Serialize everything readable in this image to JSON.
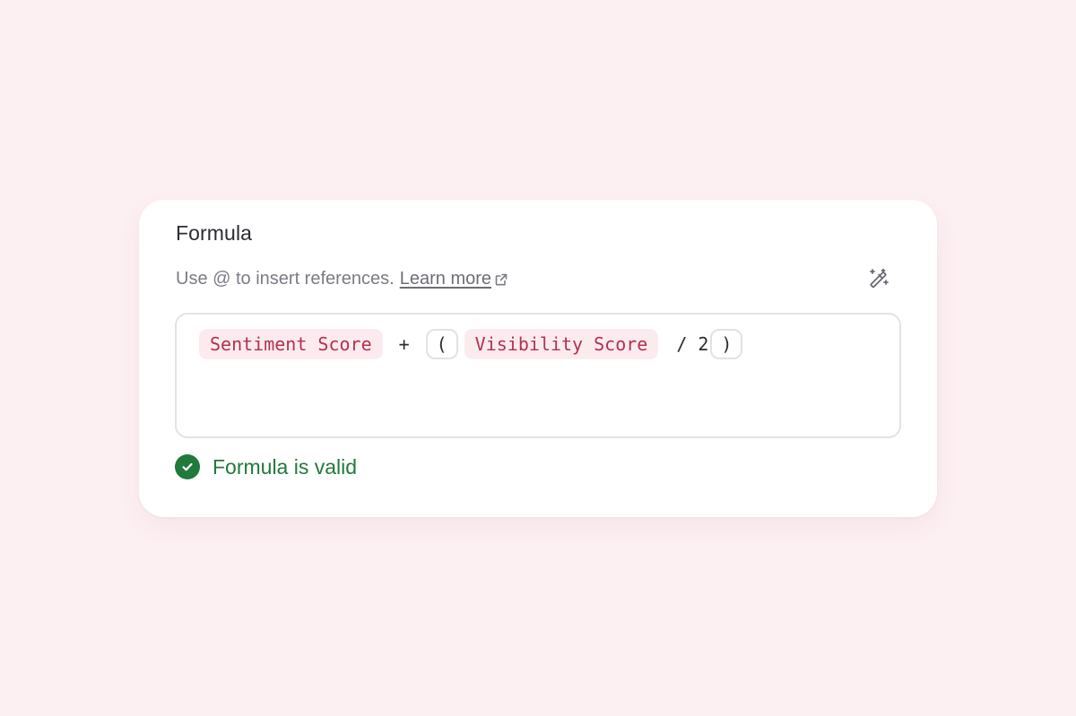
{
  "formula_panel": {
    "title": "Formula",
    "hint_text": "Use @ to insert references.",
    "learn_more_label": "Learn more",
    "wand_icon": "magic-wand-sparkles-icon",
    "expression": {
      "ref1": "Sentiment Score",
      "plus": "+",
      "open_paren": "(",
      "ref2": "Visibility Score",
      "div": "/ 2",
      "close_paren": ")"
    },
    "status_text": "Formula is valid",
    "status_icon": "check-circle-icon"
  },
  "colors": {
    "background": "#fdf0f2",
    "reference_text": "#b3314f",
    "reference_bg": "#fcebee",
    "valid": "#1f7a3c"
  }
}
